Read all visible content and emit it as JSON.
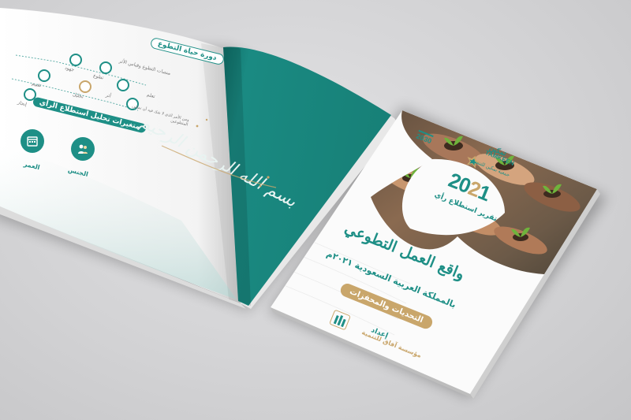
{
  "scene": {
    "background_color": "#d4d4d6",
    "accent_teal": "#1e8f86",
    "accent_gold": "#c9a66b"
  },
  "open_brochure": {
    "left_page": {
      "section_title": "دورة حياة التطوع",
      "section_subtitle": "منصات التطوع وقياس الأثر",
      "steps": [
        "جهود",
        "تطوع",
        "تقييم",
        "تحليل",
        "إنجاز",
        "أثر",
        "تعلم"
      ],
      "side_note": "ومن الأمر الذي لا شك فيه أن تمكين المتطوعين",
      "analysis_title": "متغيرات تحليل استطلاع الرأي",
      "variables": [
        "العمر",
        "الجنس"
      ],
      "variable_icons": [
        "calendar-icon",
        "people-icon"
      ]
    },
    "right_page": {
      "calligraphy": "بسم الله الرحمن الرحيم"
    }
  },
  "cover": {
    "logo_name_ar": "تمكين",
    "logo_name_en": "TAMKEEN",
    "logo_tagline": "جمعية تمكين للتنمية",
    "vision_logo": "2030",
    "year_prefix": "20",
    "year_highlight": "2",
    "year_suffix": "1",
    "subtitle": "تقرير استطلاع رأي",
    "title": "واقع العمل التطوعي",
    "title_line2": "بالمملكة العربية السعودية ٢٠٢١م",
    "pill": "التحديات والمحفزات",
    "prepared_by_label": "إعداد",
    "prepared_by_name": "مؤسسة آفاق للتنمية",
    "publisher_icon": "books-icon",
    "photo_description_icon": "hands-with-seedlings-photo"
  }
}
